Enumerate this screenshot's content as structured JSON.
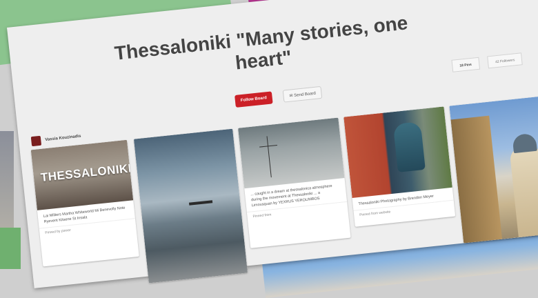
{
  "board": {
    "title": "Thessaloniki \"Many stories, one heart\"",
    "follow_label": "Follow Board",
    "send_label": "✉ Send Board",
    "tabs": {
      "pins": "18 Pins",
      "followers": "42 Followers"
    },
    "owner": {
      "name": "Vassia Kouzinadis"
    }
  },
  "pins": [
    {
      "image_text": "THESSALONIKI",
      "description": "Lai Milliers Martha Whiteworld Mi Benevolly Note Ryevent Kitsene St Insala",
      "meta": "Pinned by pinner"
    },
    {
      "description": "",
      "meta": ""
    },
    {
      "description": "... caught in a dream at thessalonica atmosphere during the movement at Thessaloniki ... a Limousquan by YEXRUS YEROLIMBOS",
      "meta": "Pinned from"
    },
    {
      "description": "Thessaloniki Photography by Brendon Meyer",
      "meta": "Pinned from website"
    },
    {
      "description": "",
      "meta": ""
    }
  ],
  "colors": {
    "follow_button": "#cb2027",
    "board_bg": "#eeeeee",
    "accent_green": "#8bc48e",
    "accent_magenta": "#b4348f"
  }
}
